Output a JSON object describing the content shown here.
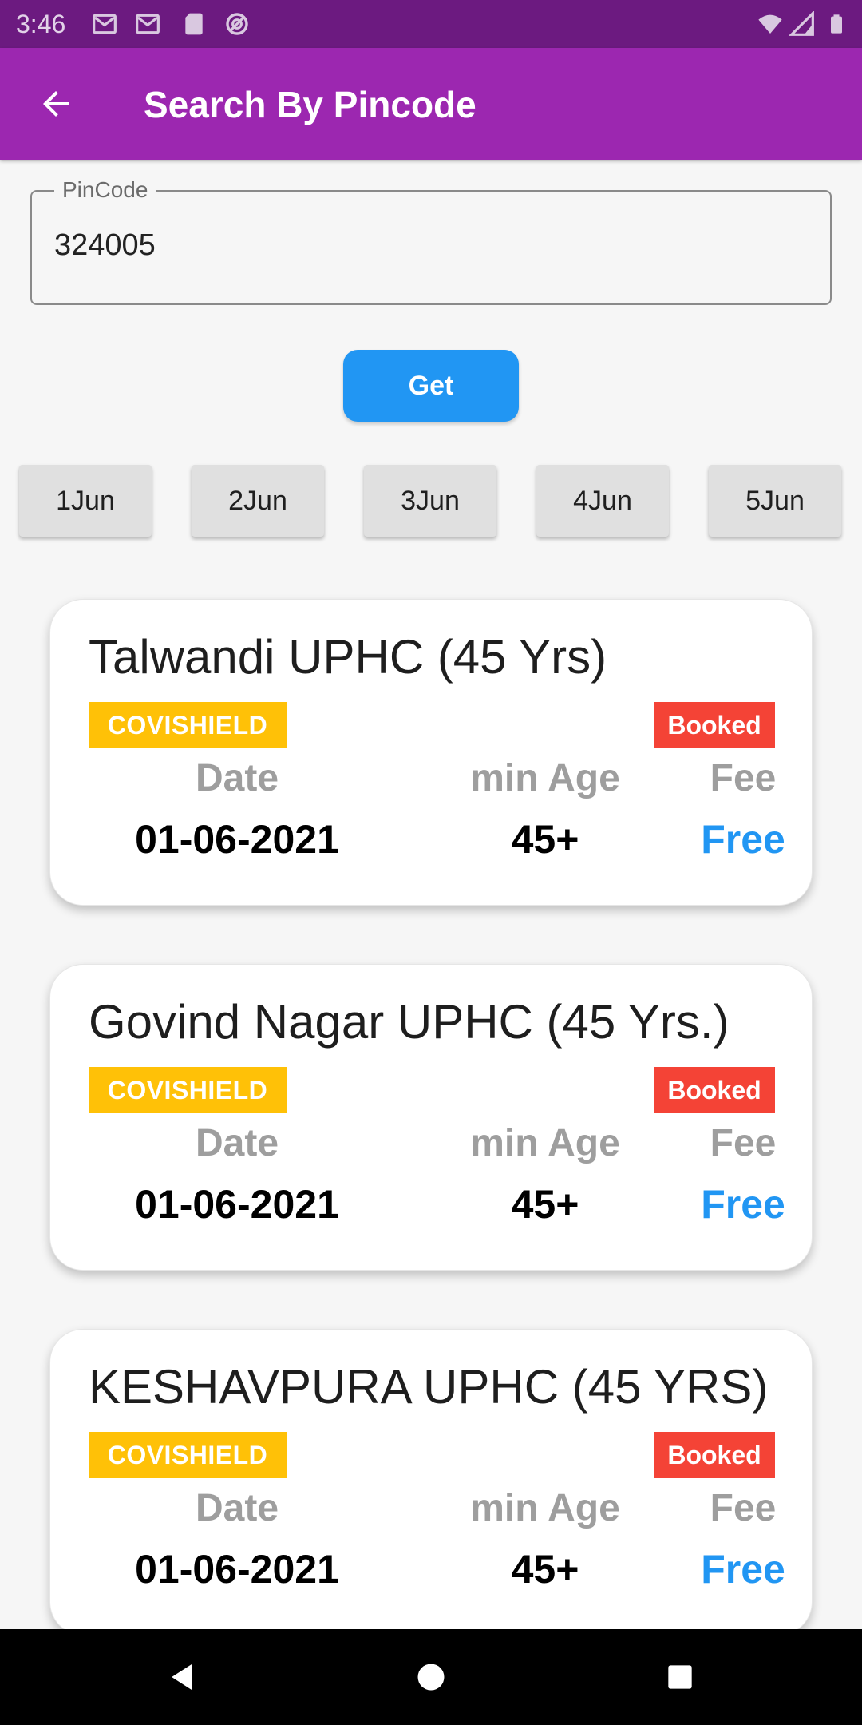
{
  "status_bar": {
    "time": "3:46",
    "left_icons": [
      "gmail-icon",
      "gmail-icon",
      "sd-card-icon",
      "vpn-icon"
    ],
    "right_icons": [
      "wifi-icon",
      "signal-icon",
      "battery-icon"
    ]
  },
  "app_bar": {
    "title": "Search By Pincode",
    "back_icon": "arrow-back-icon",
    "color": "#9c27b0"
  },
  "pincode": {
    "label": "PinCode",
    "value": "324005"
  },
  "get_button": {
    "label": "Get",
    "color": "#2196f3"
  },
  "dates": [
    "1Jun",
    "2Jun",
    "3Jun",
    "4Jun",
    "5Jun"
  ],
  "centers": [
    {
      "name": "Talwandi UPHC (45 Yrs)",
      "vaccine": "COVISHIELD",
      "status": "Booked",
      "date_label": "Date",
      "date": "01-06-2021",
      "age_label": "min Age",
      "age": "45+",
      "fee_label": "Fee",
      "fee": "Free"
    },
    {
      "name": "Govind Nagar UPHC (45 Yrs.)",
      "vaccine": "COVISHIELD",
      "status": "Booked",
      "date_label": "Date",
      "date": "01-06-2021",
      "age_label": "min Age",
      "age": "45+",
      "fee_label": "Fee",
      "fee": "Free"
    },
    {
      "name": "KESHAVPURA UPHC (45 YRS)",
      "vaccine": "COVISHIELD",
      "status": "Booked",
      "date_label": "Date",
      "date": "01-06-2021",
      "age_label": "min Age",
      "age": "45+",
      "fee_label": "Fee",
      "fee": "Free"
    }
  ],
  "colors": {
    "vaccine_badge": "#ffc107",
    "booked_badge": "#f44336",
    "fee_free": "#2196f3",
    "label_gray": "#9e9e9e"
  },
  "nav_bar": {
    "icons": [
      "back-triangle-icon",
      "home-circle-icon",
      "recents-square-icon"
    ]
  }
}
